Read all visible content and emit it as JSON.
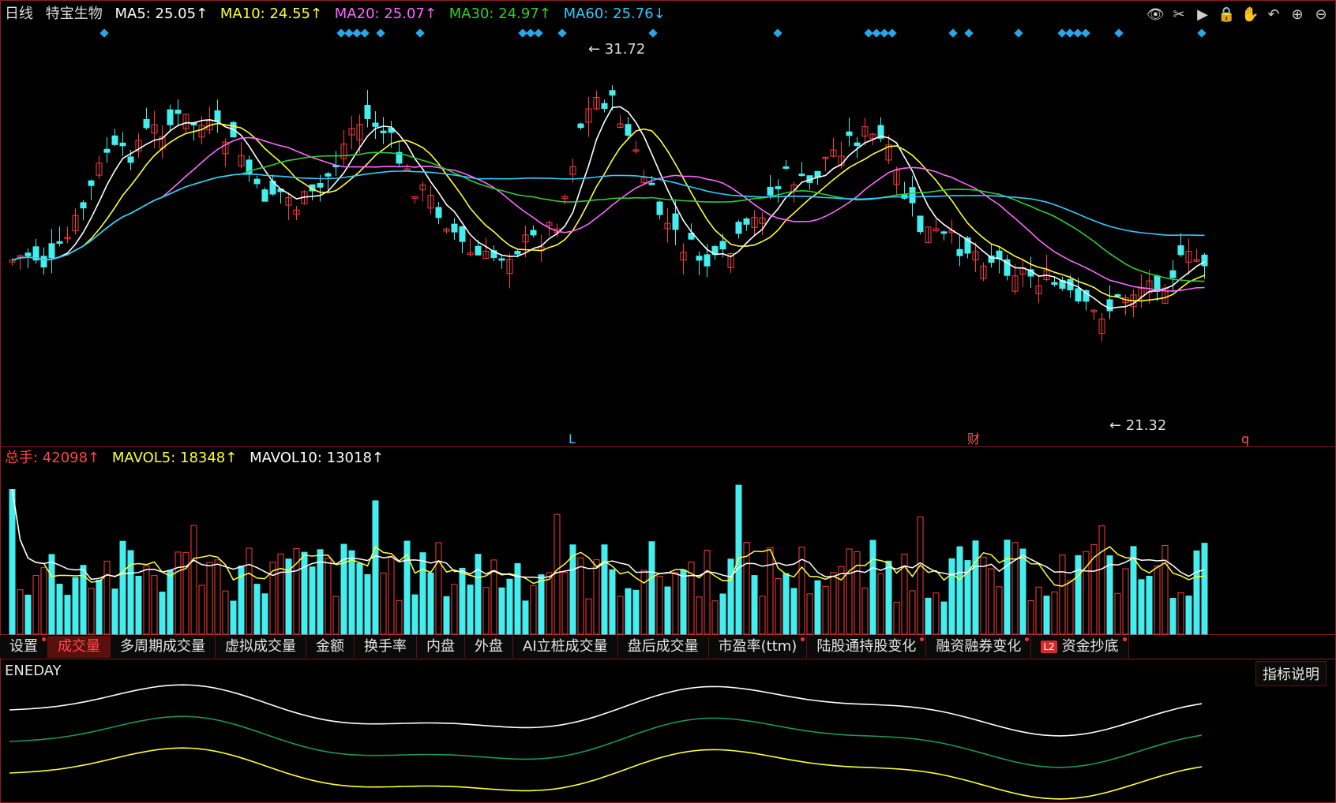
{
  "header": {
    "period": "日线",
    "stock_name": "特宝生物",
    "ma": [
      {
        "label": "MA5: 25.05↑",
        "color": "#ffffff"
      },
      {
        "label": "MA10: 24.55↑",
        "color": "#ffff33"
      },
      {
        "label": "MA20: 25.07↑",
        "color": "#ff66ff"
      },
      {
        "label": "MA30: 24.97↑",
        "color": "#33cc33"
      },
      {
        "label": "MA60: 25.76↓",
        "color": "#33ccff"
      }
    ]
  },
  "toolbar": [
    "eye-icon",
    "scissors-icon",
    "play-icon",
    "lock-icon",
    "hand-icon",
    "undo-icon",
    "zoom-in-icon",
    "zoom-out-icon"
  ],
  "price_chart": {
    "high_label": "31.72",
    "low_label": "21.32",
    "event_markers": [
      {
        "label": "L",
        "color": "#33ccff"
      },
      {
        "label": "财",
        "color": "#ff5555"
      },
      {
        "label": "q",
        "color": "#ff5555"
      }
    ]
  },
  "volume_header": {
    "items": [
      {
        "label": "总手: 42098↑",
        "color": "#ff4444"
      },
      {
        "label": "MAVOL5: 18348↑",
        "color": "#ffff33"
      },
      {
        "label": "MAVOL10: 13018↑",
        "color": "#ffffff"
      }
    ]
  },
  "tabs": [
    {
      "label": "设置",
      "active": false,
      "dot": true
    },
    {
      "label": "成交量",
      "active": true,
      "dot": false
    },
    {
      "label": "多周期成交量",
      "active": false,
      "dot": false
    },
    {
      "label": "虚拟成交量",
      "active": false,
      "dot": false
    },
    {
      "label": "金额",
      "active": false,
      "dot": false
    },
    {
      "label": "换手率",
      "active": false,
      "dot": false
    },
    {
      "label": "内盘",
      "active": false,
      "dot": false
    },
    {
      "label": "外盘",
      "active": false,
      "dot": false
    },
    {
      "label": "AI立桩成交量",
      "active": false,
      "dot": false
    },
    {
      "label": "盘后成交量",
      "active": false,
      "dot": false
    },
    {
      "label": "市盈率(ttm)",
      "active": false,
      "dot": true
    },
    {
      "label": "陆股通持股变化",
      "active": false,
      "dot": true
    },
    {
      "label": "融资融券变化",
      "active": false,
      "dot": true
    },
    {
      "label": "资金抄底",
      "active": false,
      "dot": true,
      "badge": "L2"
    }
  ],
  "indicator": {
    "name": "ENEDAY",
    "help_button": "指标说明"
  },
  "colors": {
    "up": "#ff3b3b",
    "down": "#44eeee",
    "grid": "#8a1f1f"
  }
}
